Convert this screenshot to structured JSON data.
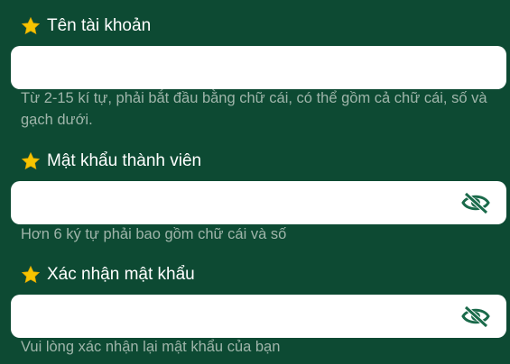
{
  "form": {
    "username": {
      "label": "Tên tài khoản",
      "value": "",
      "hint": "Từ 2-15 kí tự, phải bắt đầu bằng chữ cái, có thể gồm cả chữ cái, số và gạch dưới."
    },
    "password": {
      "label": "Mật khẩu thành viên",
      "value": "",
      "hint": "Hơn 6 ký tự phải bao gồm chữ cái và số"
    },
    "confirm_password": {
      "label": "Xác nhận mật khẩu",
      "value": "",
      "hint": "Vui lòng xác nhận lại mật khẩu của bạn"
    }
  },
  "icons": {
    "required": "star-icon",
    "toggle_visibility": "eye-slash-icon"
  },
  "colors": {
    "background": "#0d4a33",
    "star": "#f6c400",
    "eye": "#1a6a4a",
    "hint": "#9fb5aa"
  }
}
